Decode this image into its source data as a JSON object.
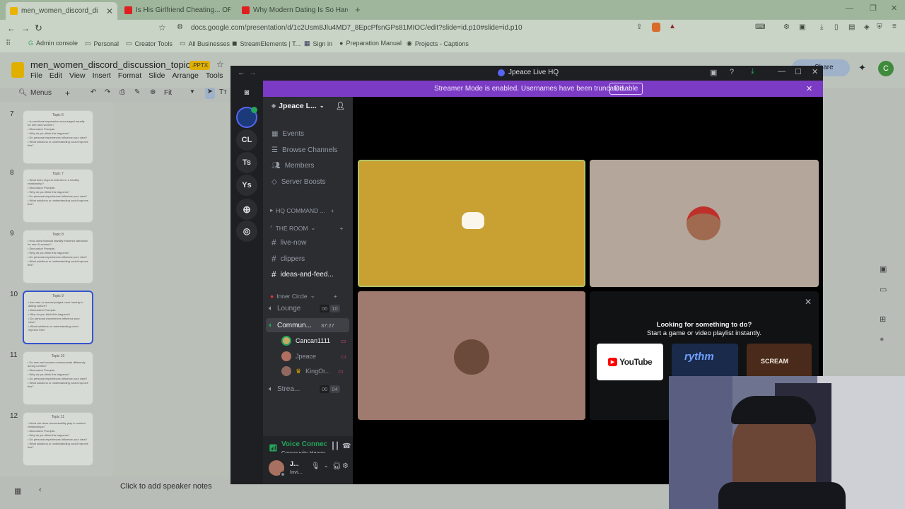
{
  "browser": {
    "tabs": [
      {
        "label": "men_women_discord_discussion",
        "color": "#e9b400",
        "active": true
      },
      {
        "label": "Is His Girlfriend Cheating... OR IS HI",
        "color": "#e02020",
        "active": false
      },
      {
        "label": "Why Modern Dating Is So Hard Righ",
        "color": "#e02020",
        "active": false
      }
    ],
    "new_tab": "+",
    "url": "docs.google.com/presentation/d/1c2Usm8Jlu4MD7_8EpcPfsnGPs81MIOC/edit?slide=id.p10#slide=id.p10",
    "bookmarks": [
      "Admin console",
      "Personal",
      "Creator Tools",
      "All Businesses",
      "StreamElements | T...",
      "Sign in",
      "Preparation Manual",
      "Projects - Captions"
    ]
  },
  "slides": {
    "doc_title": "men_women_discord_discussion_topics",
    "badge": ".PPTX",
    "menu": [
      "File",
      "Edit",
      "View",
      "Insert",
      "Format",
      "Slide",
      "Arrange",
      "Tools",
      "H"
    ],
    "toolbar": {
      "menus": "Menus",
      "zoom": "Fit"
    },
    "share_label": "Share",
    "avatar_letter": "C",
    "thumbnails": [
      {
        "num": "7",
        "title": "Topic 6",
        "lines": [
          "• Is emotional expression encouraged equally for men and women?",
          "• Discussion Prompts:",
          "• Why do you think this happens?",
          "• Do personal experiences influence your view?",
          "• What solutions or understanding could improve this?"
        ]
      },
      {
        "num": "8",
        "title": "Topic 7",
        "lines": [
          "• What does respect look like in a healthy relationship?",
          "• Discussion Prompts:",
          "• Why do you think this happens?",
          "• Do personal experiences influence your view?",
          "• What solutions or understanding could improve this?"
        ]
      },
      {
        "num": "9",
        "title": "Topic 8",
        "lines": [
          "• How does financial stability influence attraction for men & women?",
          "• Discussion Prompts:",
          "• Why do you think this happens?",
          "• Do personal experiences influence your view?",
          "• What solutions or understanding could improve this?"
        ]
      },
      {
        "num": "10",
        "title": "Topic 9",
        "lines": [
          "• Are men or women judged more harshly in dating culture?",
          "• Discussion Prompts:",
          "• Why do you think this happens?",
          "• Do personal experiences influence your view?",
          "• What solutions or understanding could improve this?"
        ]
      },
      {
        "num": "11",
        "title": "Topic 10",
        "lines": [
          "• Do men and women communicate differently during conflict?",
          "• Discussion Prompts:",
          "• Why do you think this happens?",
          "• Do personal experiences influence your view?",
          "• What solutions or understanding could improve this?"
        ]
      },
      {
        "num": "12",
        "title": "Topic 11",
        "lines": [
          "• What role does accountability play in modern relationships?",
          "• Discussion Prompts:",
          "• Why do you think this happens?",
          "• Do personal experiences influence your view?",
          "• What solutions or understanding could improve this?"
        ]
      }
    ],
    "speaker_notes": "Click to add speaker notes"
  },
  "discord": {
    "window_title": "Jpeace Live HQ",
    "banner_text": "Streamer Mode is enabled. Usernames have been truncated.",
    "banner_button": "Disable",
    "guilds": [
      "CL",
      "Ts",
      "Ys"
    ],
    "server_name": "Jpeace L...",
    "nav": [
      "Events",
      "Browse Channels",
      "Members",
      "Server Boosts"
    ],
    "categories": {
      "hq": "HQ COMMAND ...",
      "room": "THE ROOM",
      "inner": "Inner Circle"
    },
    "text_channels": [
      "live-now",
      "clippers",
      "ideas-and-feed..."
    ],
    "voice_channels": [
      {
        "name": "Lounge",
        "count_a": "00",
        "count_b": "10"
      },
      {
        "name": "Commun...",
        "timer": "37:27"
      },
      {
        "name": "Strea...",
        "count_a": "00",
        "count_b": "04"
      }
    ],
    "voice_users": [
      "Cancan1111",
      "Jpeace",
      "KingOr..."
    ],
    "voice_status": {
      "title": "Voice Connecte",
      "subtitle": "Community Hango..."
    },
    "user": {
      "name": "J...",
      "status": "Invi..."
    },
    "activity": {
      "line1": "Looking for something to do?",
      "line2": "Start a game or video playlist instantly.",
      "apps": [
        "YouTube",
        "rythm",
        "SCREAM"
      ]
    },
    "colors": {
      "banner": "#7c3bc4",
      "tile_yellow": "#c9a032",
      "tile_tan": "#b4a69a",
      "tile_mauve": "#9f7a6e",
      "green": "#23a55a"
    }
  }
}
